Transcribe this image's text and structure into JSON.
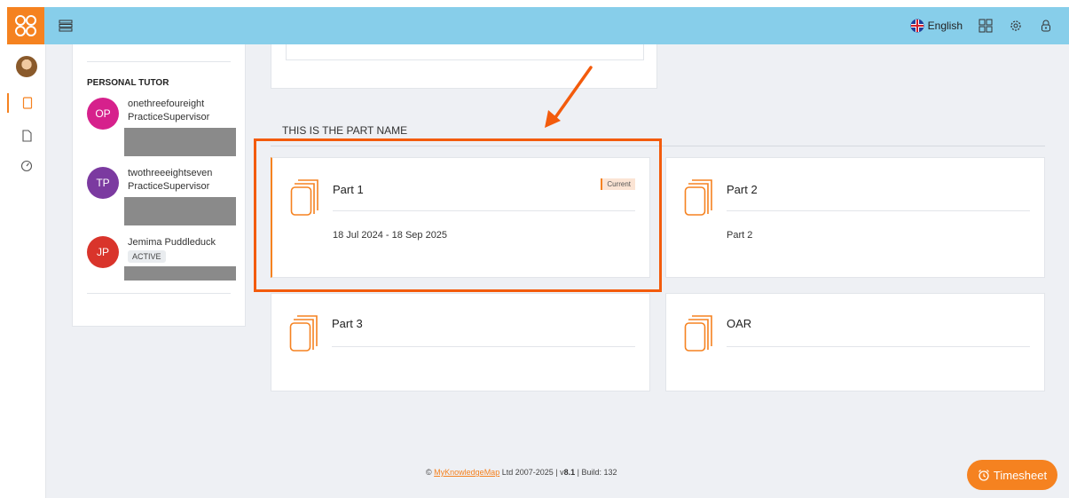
{
  "topbar": {
    "language_label": "English"
  },
  "tutor_panel": {
    "heading": "PERSONAL TUTOR",
    "people": [
      {
        "initials": "OP",
        "name": "onethreefoureight",
        "role": "PracticeSupervisor",
        "color": "#d6218c"
      },
      {
        "initials": "TP",
        "name": "twothreeeightseven",
        "role": "PracticeSupervisor",
        "color": "#7b3aa0"
      },
      {
        "initials": "JP",
        "name": "Jemima Puddleduck",
        "badge": "ACTIVE",
        "color": "#d9342b"
      }
    ]
  },
  "section": {
    "title": "THIS IS THE PART NAME"
  },
  "parts": [
    {
      "title": "Part 1",
      "subtitle": "18 Jul 2024 - 18 Sep 2025",
      "badge": "Current"
    },
    {
      "title": "Part 2",
      "subtitle": "Part 2"
    },
    {
      "title": "Part 3",
      "subtitle": ""
    },
    {
      "title": "OAR",
      "subtitle": ""
    }
  ],
  "footer": {
    "copyright": "©",
    "company_link": "MyKnowledgeMap",
    "years": "Ltd 2007-2025 |",
    "version_prefix": "v",
    "version": "8.1",
    "build_prefix": "| Build:",
    "build": "132"
  },
  "timesheet_button": {
    "label": "Timesheet"
  },
  "colors": {
    "accent": "#f58220",
    "topbar": "#87ceea",
    "highlight": "#f35b0c"
  }
}
